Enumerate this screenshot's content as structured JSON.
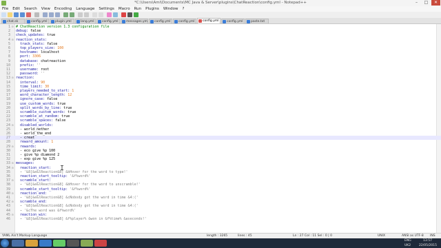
{
  "titlebar": {
    "title": "*C:\\Users\\Ami\\Documents\\MC Java & Server\\plugins\\ChatReaction\\config.yml - Notepad++",
    "minimize": "–",
    "maximize": "□",
    "close": "✕"
  },
  "menu": [
    "File",
    "Edit",
    "Search",
    "View",
    "Encoding",
    "Language",
    "Settings",
    "Macro",
    "Run",
    "Plugins",
    "Window",
    "?"
  ],
  "tabs": [
    {
      "label": "chat.sk"
    },
    {
      "label": "config.yml"
    },
    {
      "label": "plugin.yml"
    },
    {
      "label": "lang.yml"
    },
    {
      "label": "config.yml"
    },
    {
      "label": "messages.yml"
    },
    {
      "label": "config.yml"
    },
    {
      "label": "config.yml"
    },
    {
      "label": "config.yml",
      "active": true
    },
    {
      "label": "config.yml"
    },
    {
      "label": "paste.txt"
    }
  ],
  "lines": [
    [
      [
        "c",
        "# ChatReaction version 1.3 configuration file"
      ]
    ],
    [
      [
        "k",
        "debug: "
      ],
      [
        "v",
        "false"
      ]
    ],
    [
      [
        "k",
        "check_updates: "
      ],
      [
        "v",
        "true"
      ]
    ],
    [
      [
        "k",
        "reaction_stats:"
      ]
    ],
    [
      [
        "k",
        "  track_stats: "
      ],
      [
        "v",
        "false"
      ]
    ],
    [
      [
        "k",
        "  top_players_size: "
      ],
      [
        "n",
        "100"
      ]
    ],
    [
      [
        "k",
        "  hostname: "
      ],
      [
        "v",
        "localhost"
      ]
    ],
    [
      [
        "k",
        "  port: "
      ],
      [
        "n",
        "3306"
      ]
    ],
    [
      [
        "k",
        "  database: "
      ],
      [
        "v",
        "chatreaction"
      ]
    ],
    [
      [
        "k",
        "  prefix: "
      ],
      [
        "s",
        "''"
      ]
    ],
    [
      [
        "k",
        "  username: "
      ],
      [
        "v",
        "root"
      ]
    ],
    [
      [
        "k",
        "  password: "
      ],
      [
        "s",
        "''"
      ]
    ],
    [
      [
        "k",
        "reaction:"
      ]
    ],
    [
      [
        "k",
        "  interval: "
      ],
      [
        "n",
        "90"
      ]
    ],
    [
      [
        "k",
        "  time_limit: "
      ],
      [
        "n",
        "30"
      ]
    ],
    [
      [
        "k",
        "  players_needed_to_start: "
      ],
      [
        "n",
        "1"
      ]
    ],
    [
      [
        "k",
        "  word_character_length: "
      ],
      [
        "n",
        "12"
      ]
    ],
    [
      [
        "k",
        "  ignore_case: "
      ],
      [
        "v",
        "false"
      ]
    ],
    [
      [
        "k",
        "  use_custom_words: "
      ],
      [
        "v",
        "true"
      ]
    ],
    [
      [
        "k",
        "  split_words_by_line: "
      ],
      [
        "v",
        "true"
      ]
    ],
    [
      [
        "k",
        "  scramble_custom_words: "
      ],
      [
        "v",
        "true"
      ]
    ],
    [
      [
        "k",
        "  scramble_at_random: "
      ],
      [
        "v",
        "true"
      ]
    ],
    [
      [
        "k",
        "  scramble_spaces: "
      ],
      [
        "v",
        "false"
      ]
    ],
    [
      [
        "k",
        "  disabled_worlds:"
      ]
    ],
    [
      [
        "v",
        "  - world_nether"
      ]
    ],
    [
      [
        "v",
        "  - world_the_end"
      ]
    ],
    [
      [
        "v",
        "  - creat"
      ]
    ],
    [
      [
        "k",
        "  reward_amount: "
      ],
      [
        "n",
        "1"
      ]
    ],
    [
      [
        "k",
        "  rewards:"
      ]
    ],
    [
      [
        "v",
        "  - eco give %p 100"
      ]
    ],
    [
      [
        "v",
        "  - give %p diamond 2"
      ]
    ],
    [
      [
        "v",
        "  - exp give %p 125"
      ]
    ],
    [
      [
        "k",
        "messages:"
      ]
    ],
    [
      [
        "k",
        "  reaction_start:"
      ]
    ],
    [
      [
        "v",
        "  - "
      ],
      [
        "s",
        "'&8[&e&lReaction&8] &bHover for the word to type!'"
      ]
    ],
    [
      [
        "k",
        "  reaction_start_tooltip: "
      ],
      [
        "s",
        "'&f%word%'"
      ]
    ],
    [
      [
        "k",
        "  scramble_start:"
      ]
    ],
    [
      [
        "v",
        "  - "
      ],
      [
        "s",
        "'&8[&e&lReaction&8] &bHover for the word to unscramble!'"
      ]
    ],
    [
      [
        "k",
        "  scramble_start_tooltip: "
      ],
      [
        "s",
        "'&f%word%'"
      ]
    ],
    [
      [
        "k",
        "  reaction_end:"
      ]
    ],
    [
      [
        "v",
        "  - "
      ],
      [
        "s",
        "'&8[&e&lReaction&8] &cNobody got the word in time &4:('"
      ]
    ],
    [
      [
        "k",
        "  scramble_end:"
      ]
    ],
    [
      [
        "v",
        "  - "
      ],
      [
        "s",
        "'&8[&e&lReaction&8] &cNobody got the word in time &4:('"
      ]
    ],
    [
      [
        "v",
        "  - "
      ],
      [
        "s",
        "'&cThe word was &f%word%'"
      ]
    ],
    [
      [
        "k",
        "  reaction_win:"
      ]
    ],
    [
      [
        "v",
        "  - "
      ],
      [
        "s",
        "'&8[&e&lReaction&8] &f%player% &won in &f%time% &aseconds!'"
      ]
    ]
  ],
  "current_line": 27,
  "status": {
    "filetype": "YAML Ain't Markup Language",
    "length": "length : 3265",
    "lines": "lines : 45",
    "position": "Ln : 27   Col : 11   Sel : 0 | 0",
    "eol": "UNIX",
    "encoding": "ANSI as UTF-8",
    "mode": "INS"
  },
  "tray": {
    "lang": "ENG",
    "region": "UK2",
    "time": "13:57",
    "date": "22/05/2015"
  },
  "colors": {
    "accent": "#3b7dd8",
    "keyword": "#1a1aa6",
    "number": "#e2771c",
    "comment": "#008000",
    "string": "#808080"
  }
}
